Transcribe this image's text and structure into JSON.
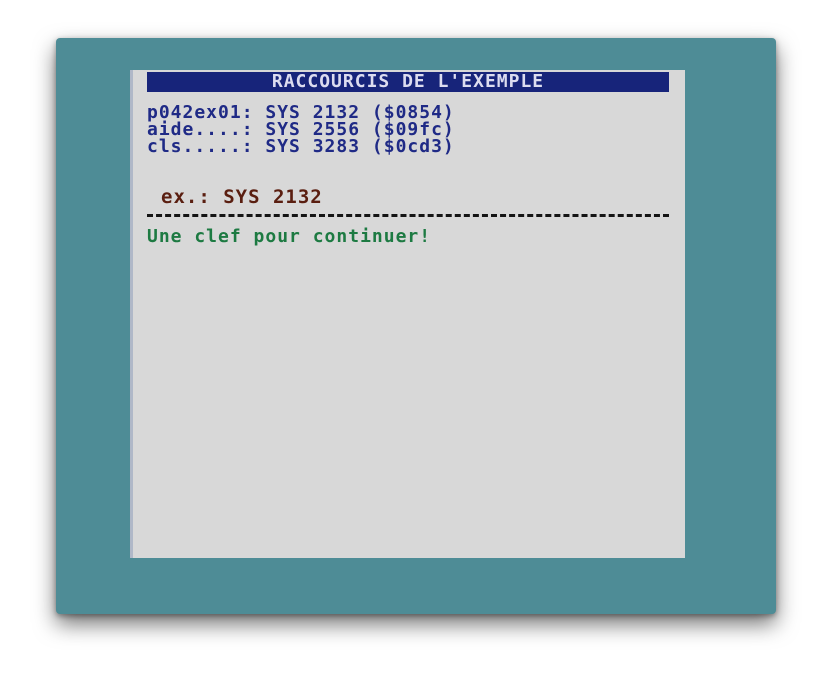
{
  "screen": {
    "title": "RACCOURCIS DE L'EXEMPLE",
    "shortcuts": [
      {
        "text": "p042ex01: SYS 2132 ($0854)"
      },
      {
        "text": "aide....: SYS 2556 ($09fc)"
      },
      {
        "text": "cls.....: SYS 3283 ($0cd3)"
      }
    ],
    "example": "ex.: SYS 2132",
    "prompt": "Une clef pour continuer!"
  },
  "colors": {
    "border": "#4e8c96",
    "screen_bg": "#d8d8d8",
    "title_bg": "#17247a",
    "shortcut_text": "#1f2a86",
    "example_text": "#5a1e10",
    "prompt_text": "#1d7a42"
  }
}
